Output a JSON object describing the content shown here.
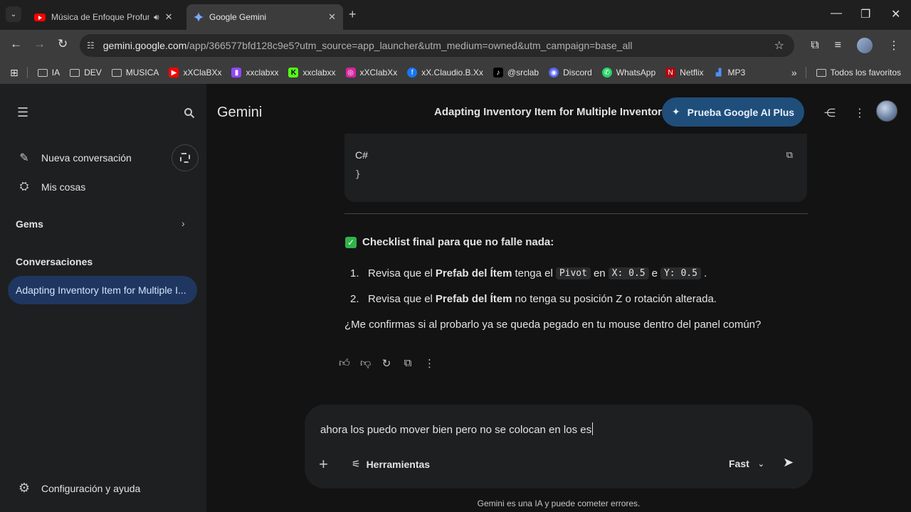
{
  "browser": {
    "tabs": [
      {
        "title": "Música de Enfoque Profundo",
        "favicon": "youtube-icon",
        "audio": true,
        "active": false
      },
      {
        "title": "Google Gemini",
        "favicon": "gemini-icon",
        "active": true
      }
    ],
    "url_host": "gemini.google.com",
    "url_rest": "/app/366577bfd128c9e5?utm_source=app_launcher&utm_medium=owned&utm_campaign=base_all",
    "bookmarks": [
      {
        "label": "IA",
        "icon": "folder-icon"
      },
      {
        "label": "DEV",
        "icon": "folder-icon"
      },
      {
        "label": "MUSICA",
        "icon": "folder-icon"
      },
      {
        "label": "xXClaBXx",
        "icon": "youtube-icon"
      },
      {
        "label": "xxclabxx",
        "icon": "twitch-icon"
      },
      {
        "label": "xxclabxx",
        "icon": "kick-icon"
      },
      {
        "label": "xXClabXx",
        "icon": "instagram-icon"
      },
      {
        "label": "xX.Claudio.B.Xx",
        "icon": "facebook-icon"
      },
      {
        "label": "@srclab",
        "icon": "tiktok-icon"
      },
      {
        "label": "Discord",
        "icon": "discord-icon"
      },
      {
        "label": "WhatsApp",
        "icon": "whatsapp-icon"
      },
      {
        "label": "Netflix",
        "icon": "netflix-icon"
      },
      {
        "label": "MP3",
        "icon": "chart-icon"
      }
    ],
    "all_bookmarks": "Todos los favoritos"
  },
  "sidebar": {
    "new_chat": "Nueva conversación",
    "my_stuff": "Mis cosas",
    "gems": "Gems",
    "conversations_title": "Conversaciones",
    "active_conversation": "Adapting Inventory Item for Multiple I...",
    "settings": "Configuración y ayuda"
  },
  "header": {
    "brand": "Gemini",
    "title": "Adapting Inventory Item for Multiple Inventori",
    "upgrade": "Prueba Google AI Plus"
  },
  "response": {
    "code_lang": "C#",
    "code_body": "}",
    "checklist_title": "Checklist final para que no falle nada:",
    "steps": [
      {
        "num": "1.",
        "pre": "Revisa que el",
        "bold": "Prefab del Ítem",
        "mid": "tenga el",
        "code1": "Pivot",
        "and1": "en",
        "code2": "X: 0.5",
        "and2": "e",
        "code3": "Y: 0.5",
        "post": "."
      },
      {
        "num": "2.",
        "pre": "Revisa que el",
        "bold": "Prefab del Ítem",
        "post": "no tenga su posición Z o rotación alterada."
      }
    ],
    "question": "¿Me confirmas si al probarlo ya se queda pegado en tu mouse dentro del panel común?"
  },
  "composer": {
    "text": "ahora los puedo mover bien pero no se colocan en los es",
    "tools_label": "Herramientas",
    "mode": "Fast"
  },
  "footer": "Gemini es una IA y puede cometer errores.",
  "colors": {
    "accent": "#1f4e7a",
    "active_item": "#1f3760"
  }
}
